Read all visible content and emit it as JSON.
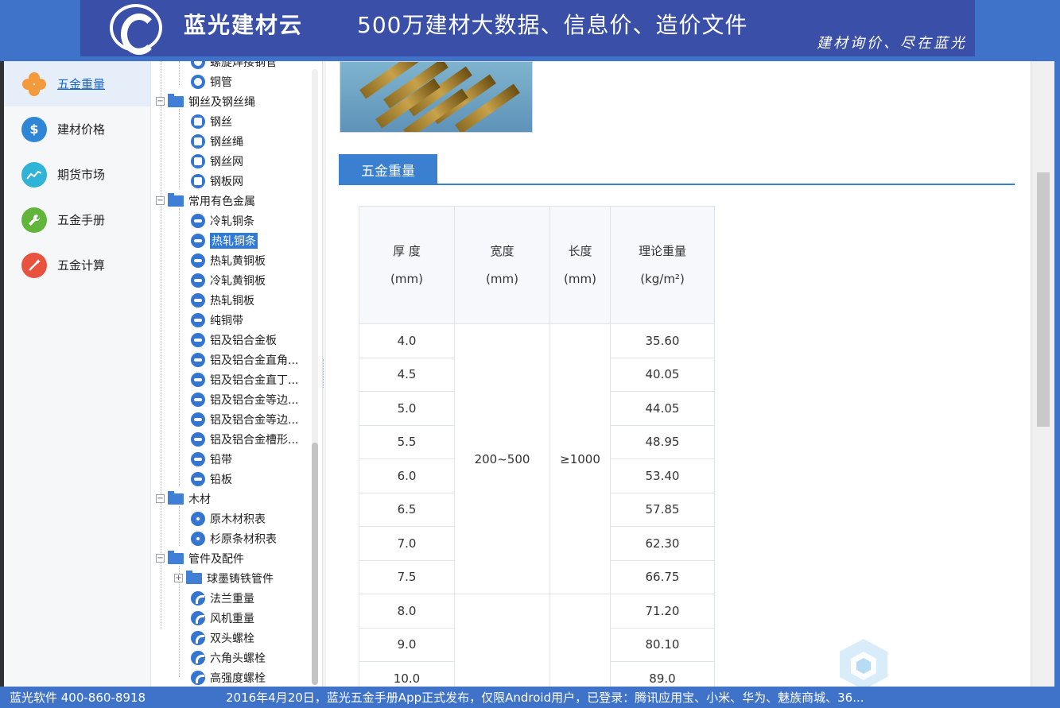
{
  "header": {
    "brand": "蓝光建材云",
    "slogan": "500万建材大数据、信息价、造价文件",
    "tagline": "建材询价、尽在蓝光",
    "colors": {
      "banner": "#3a4fa8",
      "bar": "#3f73c9"
    }
  },
  "leftnav": {
    "items": [
      {
        "label": "五金重量",
        "icon": "clover-icon",
        "color": "#f39a3d",
        "active": true
      },
      {
        "label": "建材价格",
        "icon": "dollar-icon",
        "color": "#2f86d6",
        "active": false
      },
      {
        "label": "期货市场",
        "icon": "trend-icon",
        "color": "#2fb3d6",
        "active": false
      },
      {
        "label": "五金手册",
        "icon": "wrench-icon",
        "color": "#62b53b",
        "active": false
      },
      {
        "label": "五金计算",
        "icon": "wand-icon",
        "color": "#e8533f",
        "active": false
      }
    ]
  },
  "tree": {
    "rows": [
      {
        "label": "螺旋焊接钢管",
        "type": "leaf",
        "icon": "ring"
      },
      {
        "label": "铜管",
        "type": "leaf",
        "icon": "ring"
      },
      {
        "label": "钢丝及钢丝绳",
        "type": "folder",
        "expander": "⊟"
      },
      {
        "label": "钢丝",
        "type": "leaf",
        "icon": "square"
      },
      {
        "label": "钢丝绳",
        "type": "leaf",
        "icon": "square"
      },
      {
        "label": "钢丝网",
        "type": "leaf",
        "icon": "square"
      },
      {
        "label": "钢板网",
        "type": "leaf",
        "icon": "square"
      },
      {
        "label": "常用有色金属",
        "type": "folder",
        "expander": "⊟"
      },
      {
        "label": "冷轧铜条",
        "type": "leaf",
        "icon": "bar"
      },
      {
        "label": "热轧铜条",
        "type": "leaf",
        "icon": "bar",
        "selected": true
      },
      {
        "label": "热轧黄铜板",
        "type": "leaf",
        "icon": "bar"
      },
      {
        "label": "冷轧黄铜板",
        "type": "leaf",
        "icon": "bar"
      },
      {
        "label": "热轧铜板",
        "type": "leaf",
        "icon": "bar"
      },
      {
        "label": "纯铜带",
        "type": "leaf",
        "icon": "bar"
      },
      {
        "label": "铝及铝合金板",
        "type": "leaf",
        "icon": "bar"
      },
      {
        "label": "铝及铝合金直角...",
        "type": "leaf",
        "icon": "bar"
      },
      {
        "label": "铝及铝合金直丁...",
        "type": "leaf",
        "icon": "bar"
      },
      {
        "label": "铝及铝合金等边...",
        "type": "leaf",
        "icon": "bar"
      },
      {
        "label": "铝及铝合金等边...",
        "type": "leaf",
        "icon": "bar"
      },
      {
        "label": "铝及铝合金槽形...",
        "type": "leaf",
        "icon": "bar"
      },
      {
        "label": "铅带",
        "type": "leaf",
        "icon": "bar"
      },
      {
        "label": "铅板",
        "type": "leaf",
        "icon": "bar"
      },
      {
        "label": "木材",
        "type": "folder",
        "expander": "⊟"
      },
      {
        "label": "原木材积表",
        "type": "leaf",
        "icon": "target"
      },
      {
        "label": "杉原条材积表",
        "type": "leaf",
        "icon": "target"
      },
      {
        "label": "管件及配件",
        "type": "folder",
        "expander": "⊟"
      },
      {
        "label": "球墨铸铁管件",
        "type": "subfolder",
        "expander": "⊞"
      },
      {
        "label": "法兰重量",
        "type": "leaf",
        "icon": "turn"
      },
      {
        "label": "风机重量",
        "type": "leaf",
        "icon": "turn"
      },
      {
        "label": "双头螺栓",
        "type": "leaf",
        "icon": "turn"
      },
      {
        "label": "六角头螺栓",
        "type": "leaf",
        "icon": "turn"
      },
      {
        "label": "高强度螺栓",
        "type": "leaf",
        "icon": "turn"
      }
    ]
  },
  "content": {
    "section_title": "五金重量",
    "table": {
      "headers": [
        {
          "name": "厚 度",
          "unit": "(mm)"
        },
        {
          "name": "宽度",
          "unit": "(mm)"
        },
        {
          "name": "长度",
          "unit": "(mm)"
        },
        {
          "name": "理论重量",
          "unit": "(kg/m²)"
        }
      ],
      "width_value": "200~500",
      "length_value": "≥1000",
      "rows": [
        {
          "thickness": "4.0",
          "weight": "35.60"
        },
        {
          "thickness": "4.5",
          "weight": "40.05"
        },
        {
          "thickness": "5.0",
          "weight": "44.05"
        },
        {
          "thickness": "5.5",
          "weight": "48.95"
        },
        {
          "thickness": "6.0",
          "weight": "53.40"
        },
        {
          "thickness": "6.5",
          "weight": "57.85"
        },
        {
          "thickness": "7.0",
          "weight": "62.30"
        },
        {
          "thickness": "7.5",
          "weight": "66.75"
        },
        {
          "thickness": "8.0",
          "weight": "71.20"
        },
        {
          "thickness": "9.0",
          "weight": "80.10"
        },
        {
          "thickness": "10.0",
          "weight": "89.0"
        }
      ]
    }
  },
  "status": {
    "company": "蓝光软件 400-860-8918",
    "news": "2016年4月20日，蓝光五金手册App正式发布，仅限Android用户，已登录：腾讯应用宝、小米、华为、魅族商城、36..."
  }
}
